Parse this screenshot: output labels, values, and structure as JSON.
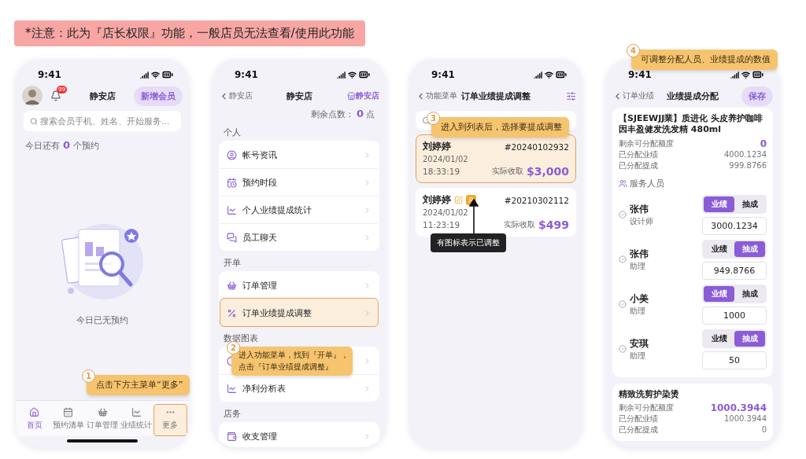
{
  "notice": "*注意：此为『店长权限』功能，一般店员无法查看/使用此功能",
  "home": {
    "time": "9:41",
    "notification_count": "99",
    "title": "静安店",
    "add_member_button": "新增会员",
    "search": {
      "placeholder": "搜索会员手机、姓名、开始服务..."
    },
    "appointments": {
      "prefix": "今日还有",
      "count": "0",
      "suffix": "个预约"
    },
    "empty_text": "今日已无预约",
    "callout": {
      "step": "1",
      "lines": [
        "点击下方主菜单“更多”"
      ]
    },
    "tabs": [
      {
        "label": "首页",
        "selected": true,
        "highlighted": false
      },
      {
        "label": "预约清单",
        "selected": false,
        "highlighted": false
      },
      {
        "label": "订单管理",
        "selected": false,
        "highlighted": false
      },
      {
        "label": "业绩统计",
        "selected": false,
        "highlighted": false
      },
      {
        "label": "更多",
        "selected": false,
        "highlighted": true
      }
    ]
  },
  "menu": {
    "time": "9:41",
    "back": "静安店",
    "title": "静安店",
    "store": "静安店",
    "points": {
      "label": "剩余点数：",
      "value": "0",
      "unit": "点"
    },
    "sections": [
      {
        "title": "个人",
        "items": [
          {
            "label": "帐号资讯",
            "highlighted": false
          },
          {
            "label": "预约时段",
            "highlighted": false
          },
          {
            "label": "个人业绩提成统计",
            "highlighted": false
          },
          {
            "label": "员工聊天",
            "highlighted": false
          }
        ]
      },
      {
        "title": "开单",
        "items": [
          {
            "label": "订单管理",
            "highlighted": false
          },
          {
            "label": "订单业绩提成调整",
            "highlighted": true
          }
        ]
      },
      {
        "title": "数据图表",
        "items": [
          {
            "highlighted": false
          },
          {
            "label": "净利分析表",
            "highlighted": false
          }
        ]
      },
      {
        "title": "店务",
        "items": [
          {
            "label": "收支管理",
            "highlighted": false
          }
        ]
      }
    ],
    "callout": {
      "step": "2",
      "lines": [
        "进入功能菜单，找到『开单』，",
        "点击『订单业绩提成调整』"
      ]
    }
  },
  "orders": {
    "time": "9:41",
    "back": "功能菜单",
    "title": "订单业绩提成调整",
    "callout": {
      "step": "3",
      "lines": [
        "进入到列表后，选择要提成调整"
      ]
    },
    "tooltip": "有图标表示已调整",
    "items": [
      {
        "name": "刘婷婷",
        "number": "#20240102932",
        "date": "2024/01/02",
        "time": "18:33:19",
        "amount_label": "实际收取",
        "amount": "$3,000",
        "highlighted": true,
        "adjusted": false
      },
      {
        "name": "刘婷婷",
        "number": "#20210302112",
        "date": "2024/01/02",
        "time": "11:23:19",
        "amount_label": "实际收取",
        "amount": "$499",
        "highlighted": false,
        "adjusted": true
      }
    ]
  },
  "allocation": {
    "time": "9:41",
    "back": "订单业绩",
    "title": "业绩提成分配",
    "save_button": "保存",
    "callout": {
      "step": "4",
      "lines": [
        "可调整分配人员、业绩提成的数值"
      ]
    },
    "products": [
      {
        "name": "【SJEEWJJ業】质进化 头皮养护咖啡因丰盈健发洗发精 480ml",
        "stats": [
          {
            "label": "剩余可分配额度",
            "value": "0",
            "emphasis": true
          },
          {
            "label": "已分配业绩",
            "value": "4000.1234",
            "emphasis": false
          },
          {
            "label": "已分配提成",
            "value": "999.8766",
            "emphasis": false
          }
        ],
        "staff_heading": "服务人员",
        "staff": [
          {
            "name": "张伟",
            "role": "设计师",
            "checked": true,
            "options": [
              {
                "label": "业绩",
                "selected": true
              },
              {
                "label": "抽成",
                "selected": false
              }
            ],
            "value": "3000.1234"
          },
          {
            "name": "张伟",
            "role": "助理",
            "checked": true,
            "options": [
              {
                "label": "业绩",
                "selected": false
              },
              {
                "label": "抽成",
                "selected": true
              }
            ],
            "value": "949.8766"
          },
          {
            "name": "小美",
            "role": "助理",
            "checked": true,
            "options": [
              {
                "label": "业绩",
                "selected": true
              },
              {
                "label": "抽成",
                "selected": false
              }
            ],
            "value": "1000"
          },
          {
            "name": "安琪",
            "role": "助理",
            "checked": true,
            "options": [
              {
                "label": "业绩",
                "selected": false
              },
              {
                "label": "抽成",
                "selected": true
              }
            ],
            "value": "50"
          }
        ]
      },
      {
        "name": "精致洗剪护染烫",
        "stats": [
          {
            "label": "剩余可分配额度",
            "value": "1000.3944",
            "emphasis": true
          },
          {
            "label": "已分配业绩",
            "value": "1000.3944",
            "emphasis": false
          },
          {
            "label": "已分配提成",
            "value": "0",
            "emphasis": false
          }
        ]
      }
    ]
  }
}
